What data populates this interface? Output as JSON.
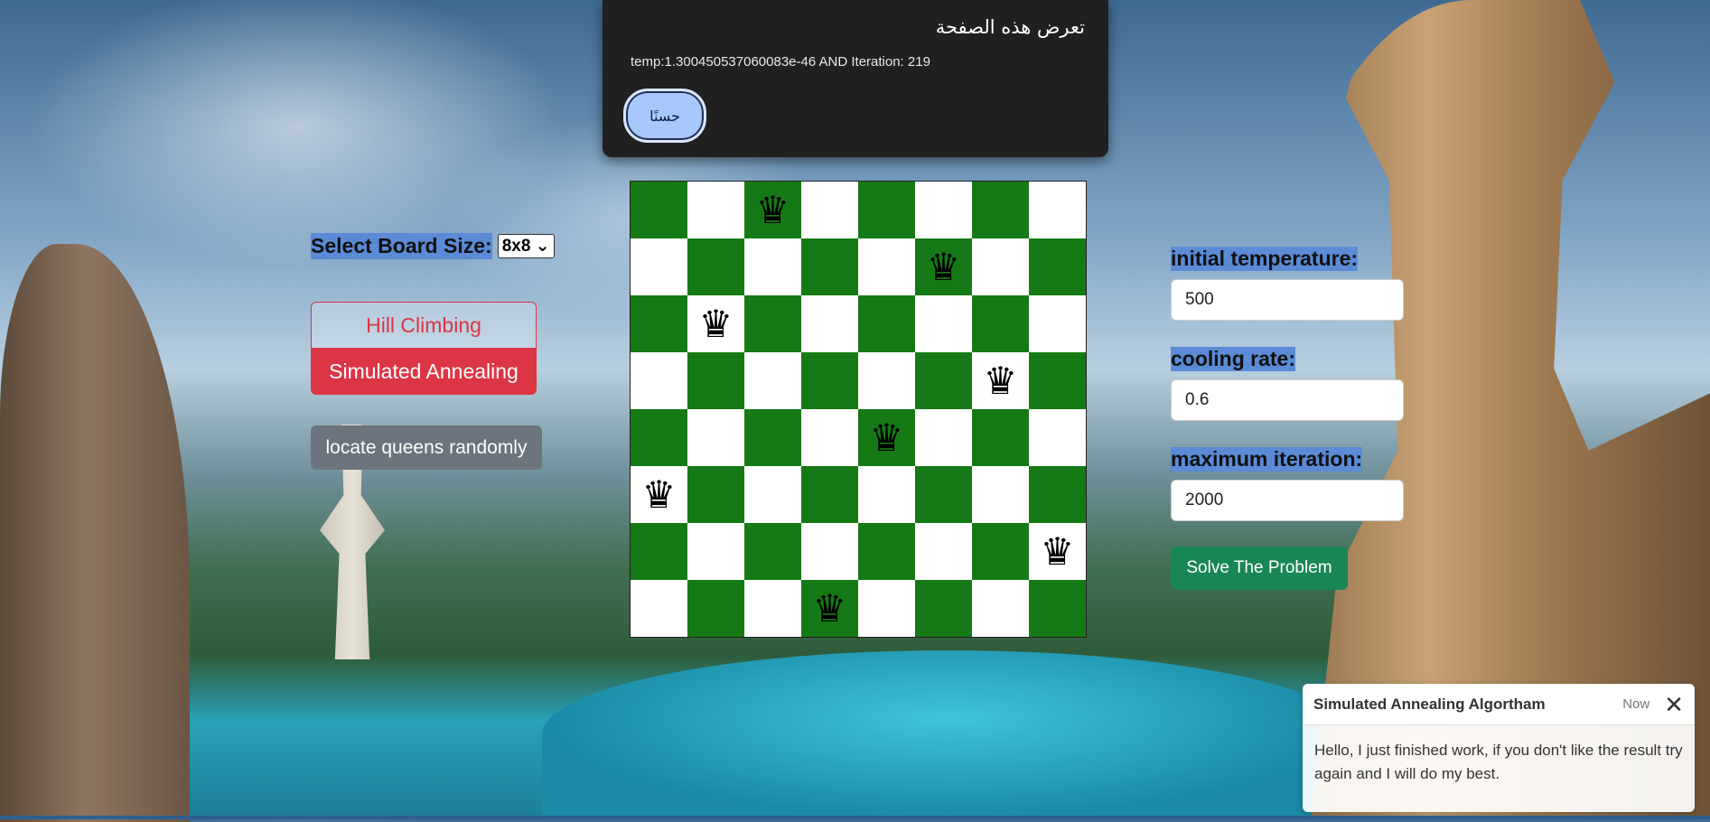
{
  "dialog": {
    "title": "تعرض هذه الصفحة",
    "message": "temp:1.300450537060083e-46   AND   Iteration: 219",
    "ok_label": "حسنًا"
  },
  "controls": {
    "board_size_label": "Select Board Size:",
    "board_size_value": "8x8 ⌄",
    "hill_climbing_label": "Hill Climbing",
    "simulated_annealing_label": "Simulated Annealing",
    "random_button_label": "locate queens randomly"
  },
  "board": {
    "size": 8,
    "queen_columns_by_row": [
      2,
      5,
      1,
      6,
      4,
      0,
      7,
      3
    ],
    "queen_glyph": "♛",
    "dark_color": "#157a15",
    "light_color": "#ffffff"
  },
  "params": {
    "initial_temperature_label": "initial temperature:",
    "initial_temperature_value": "500",
    "cooling_rate_label": "cooling rate:",
    "cooling_rate_value": "0.6",
    "max_iteration_label": "maximum iteration:",
    "max_iteration_value": "2000",
    "solve_label": "Solve The Problem"
  },
  "toast": {
    "title": "Simulated Annealing Algortham",
    "time": "Now",
    "body": "Hello, I just finished work, if you don't like the result try again and I will do my best."
  },
  "colors": {
    "danger": "#dc3545",
    "secondary": "#6c757d",
    "success": "#198754",
    "highlight": "#5b8bd6"
  }
}
